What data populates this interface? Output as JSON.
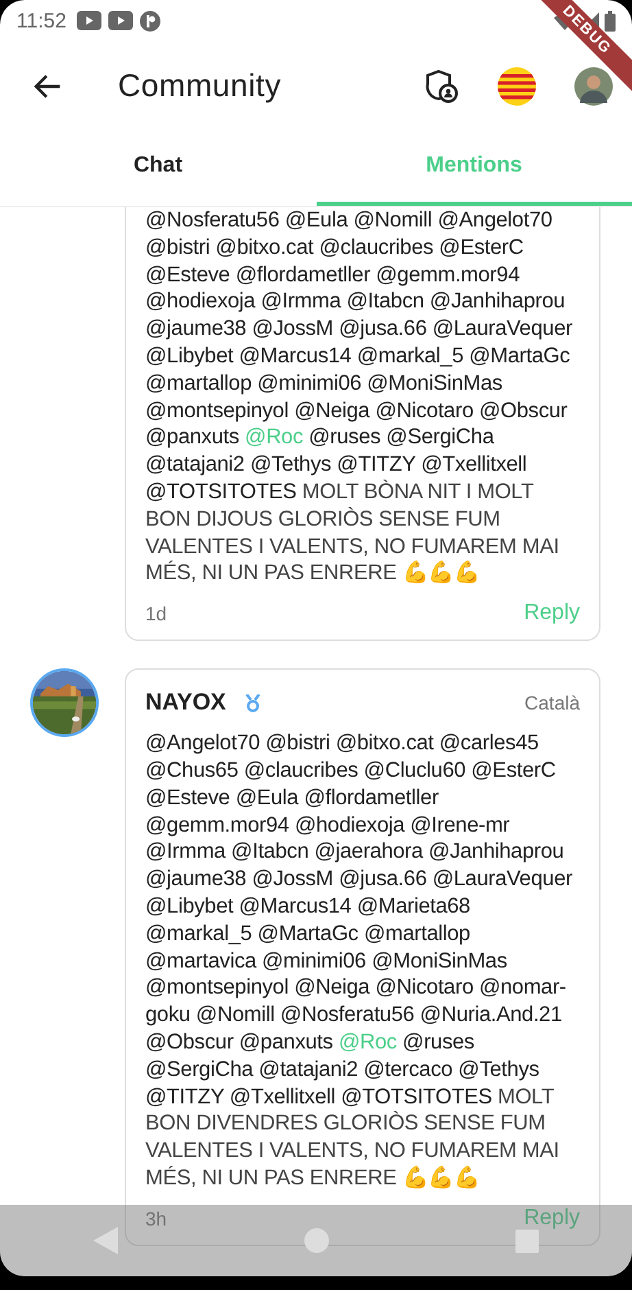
{
  "status_bar": {
    "time": "11:52"
  },
  "debug_banner": "DEBUG",
  "app_bar": {
    "title": "Community"
  },
  "tabs": [
    {
      "label": "Chat",
      "selected": false
    },
    {
      "label": "Mentions",
      "selected": true
    }
  ],
  "messages": [
    {
      "body": [
        {
          "kind": "mention",
          "text": "@Nosferatu56 @Eula @Nomill @Angelot70 @bistri @bitxo.cat @claucribes @EsterC @Esteve @flordametller @gemm.mor94 @hodiexoja @Irmma @Itabcn @Janhihaprou @jaume38 @JossM @jusa.66 @LauraVequer @Libybet @Marcus14 @markal_5 @MartaGc @martallop @minimi06 @MoniSinMas @montsepinyol @Neiga @Nicotaro @Obscur @panxuts "
        },
        {
          "kind": "self",
          "text": "@Roc"
        },
        {
          "kind": "mention",
          "text": " @ruses @SergiCha @tatajani2 @Tethys @TITZY @Txellitxell @TOTSITOTES"
        },
        {
          "kind": "text",
          "text": " MOLT BÒNA NIT I MOLT BON DIJOUS GLORIÒS SENSE FUM VALENTES I VALENTS, NO FUMAREM MAI MÉS, NI UN PAS ENRERE 💪💪💪"
        }
      ],
      "time": "1d",
      "reply": "Reply"
    },
    {
      "author": "NAYOX",
      "language": "Català",
      "body": [
        {
          "kind": "mention",
          "text": "@Angelot70 @bistri @bitxo.cat @carles45 @Chus65 @claucribes @Cluclu60 @EsterC @Esteve @Eula @flordametller @gemm.mor94 @hodiexoja @Irene-mr @Irmma @Itabcn @jaerahora @Janhihaprou @jaume38 @JossM @jusa.66 @LauraVequer @Libybet @Marcus14 @Marieta68 @markal_5 @MartaGc @martallop @martavica @minimi06 @MoniSinMas @montsepinyol @Neiga @Nicotaro @nomar-goku @Nomill @Nosferatu56 @Nuria.And.21 @Obscur @panxuts "
        },
        {
          "kind": "self",
          "text": "@Roc"
        },
        {
          "kind": "mention",
          "text": " @ruses @SergiCha @tatajani2 @tercaco @Tethys @TITZY @Txellitxell @TOTSITOTES"
        },
        {
          "kind": "text",
          "text": " MOLT BON DIVENDRES GLORIÒS SENSE FUM VALENTES I VALENTS, NO FUMAREM MAI MÉS, NI UN PAS ENRERE 💪💪💪"
        }
      ],
      "time": "3h",
      "reply": "Reply"
    }
  ]
}
